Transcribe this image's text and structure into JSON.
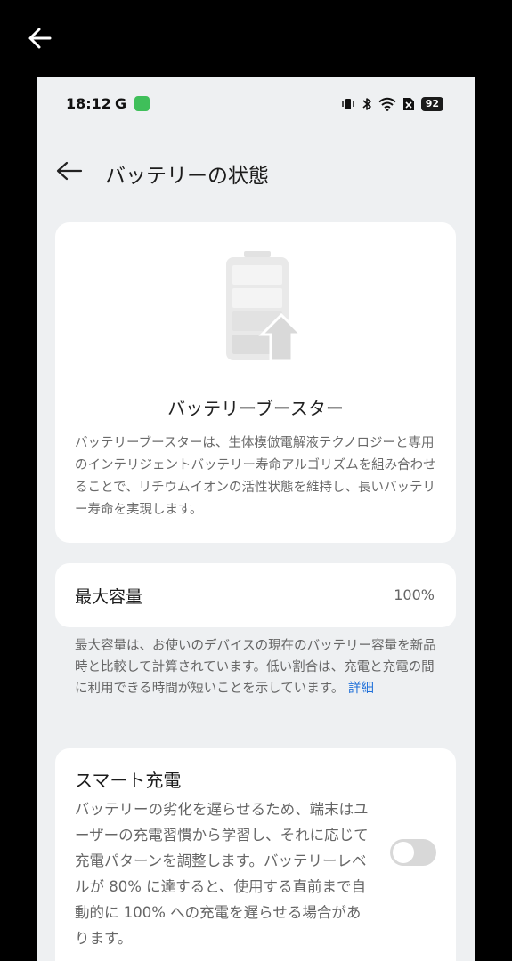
{
  "status_bar": {
    "time": "18:12",
    "carrier_letter": "G",
    "battery_level": "92"
  },
  "header": {
    "title": "バッテリーの状態"
  },
  "booster": {
    "title": "バッテリーブースター",
    "description": "バッテリーブースターは、生体模倣電解液テクノロジーと専用のインテリジェントバッテリー寿命アルゴリズムを組み合わせることで、リチウムイオンの活性状態を維持し、長いバッテリー寿命を実現します。"
  },
  "capacity": {
    "label": "最大容量",
    "value": "100%",
    "note": "最大容量は、お使いのデバイスの現在のバッテリー容量を新品時と比較して計算されています。低い割合は、充電と充電の間に利用できる時間が短いことを示しています。",
    "link_label": "詳細"
  },
  "smart_charging": {
    "title": "スマート充電",
    "description": "バッテリーの劣化を遅らせるため、端末はユーザーの充電習慣から学習し、それに応じて充電パターンを調整します。バッテリーレベルが 80% に達すると、使用する直前まで自動的に 100% への充電を遅らせる場合があります。",
    "enabled": false
  },
  "icons": {
    "outer_back": "arrow-left-icon",
    "header_back": "arrow-left-icon",
    "vibrate": "vibrate-icon",
    "bluetooth": "bluetooth-icon",
    "wifi": "wifi-icon",
    "sim": "no-sim-icon",
    "illustration": "battery-booster-icon"
  },
  "colors": {
    "link": "#1e6fd9",
    "toggle_off": "#d8d8d8",
    "background": "#eef0f2"
  }
}
